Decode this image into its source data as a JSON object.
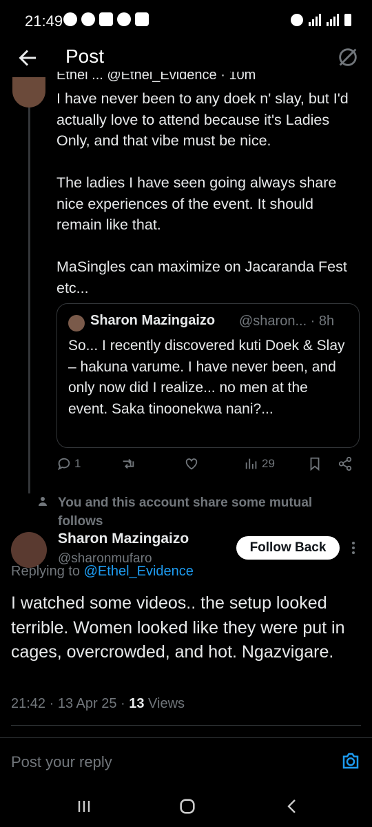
{
  "status": {
    "time": "21:49"
  },
  "header": {
    "title": "Post"
  },
  "thread": {
    "cut_name": "Ethel ... @Ethel_Evidence · 10m",
    "body": "I have never been to any doek n' slay, but I'd actually love to attend because it's Ladies Only, and that vibe must be nice.\n\nThe ladies I have seen going always share nice experiences of the event. It should remain like that.\n\nMaSingles can maximize on Jacaranda Fest etc...",
    "quote": {
      "name": "Sharon Mazingaizo",
      "handle_time": "@sharon... · 8h",
      "text": "So... I recently discovered kuti Doek & Slay – hakuna varume. I have never been, and only now did I realize... no men at the event. Saka tinoonekwa nani?..."
    },
    "actions": {
      "replies": "1",
      "views": "29"
    }
  },
  "mutual": "You and this account share some mutual follows",
  "reply": {
    "name": "Sharon Mazingaizo",
    "handle": "@sharonmufaro",
    "follow_label": "Follow Back",
    "replying_prefix": "Replying to ",
    "replying_mention": "@Ethel_Evidence",
    "body": "I watched some videos.. the setup looked terrible. Women looked like they were put in cages, overcrowded, and hot. Ngazvigare.",
    "time": "21:42 · 13 Apr 25 · ",
    "views_count": "13",
    "views_label": " Views"
  },
  "composer": {
    "placeholder": "Post your reply"
  }
}
